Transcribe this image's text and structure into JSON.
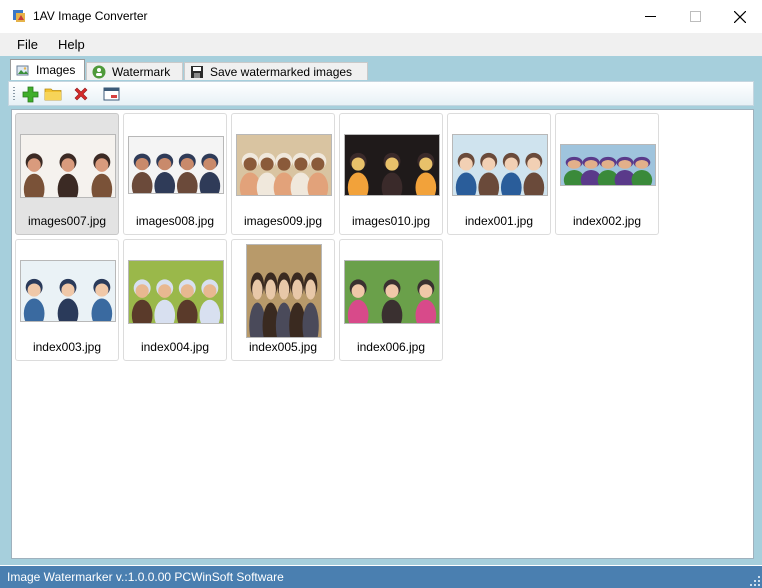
{
  "window": {
    "title": "1AV Image Converter",
    "controls": {
      "minimize": "—",
      "maximize": "☐",
      "close": "✕"
    }
  },
  "menu": {
    "items": [
      "File",
      "Help"
    ]
  },
  "tabs": [
    {
      "label": "Images",
      "icon": "images-icon",
      "active": true
    },
    {
      "label": "Watermark",
      "icon": "watermark-icon",
      "active": false
    },
    {
      "label": "Save watermarked images",
      "icon": "save-icon",
      "active": false
    }
  ],
  "toolbar": {
    "buttons": [
      {
        "name": "add-image-button",
        "icon": "plus-icon"
      },
      {
        "name": "add-folder-button",
        "icon": "folder-icon"
      },
      {
        "name": "remove-button",
        "icon": "delete-icon"
      },
      {
        "name": "preview-button",
        "icon": "window-icon"
      }
    ]
  },
  "images": [
    {
      "filename": "images007.jpg",
      "selected": true,
      "palette": [
        "#f5f2ee",
        "#7a5238",
        "#d99b7d",
        "#3b2a24"
      ]
    },
    {
      "filename": "images008.jpg",
      "selected": false,
      "palette": [
        "#f4f4f4",
        "#6b4a3a",
        "#c98a6b",
        "#2f3b58"
      ]
    },
    {
      "filename": "images009.jpg",
      "selected": false,
      "palette": [
        "#d9c4a1",
        "#e2a27a",
        "#8a5a3a",
        "#f0e8dc"
      ]
    },
    {
      "filename": "images010.jpg",
      "selected": false,
      "palette": [
        "#1f1a1a",
        "#f2a23a",
        "#e8c16a",
        "#3a2a2a"
      ]
    },
    {
      "filename": "index001.jpg",
      "selected": false,
      "palette": [
        "#cfe3ee",
        "#2a5d9a",
        "#f2d0b4",
        "#6a4a3a"
      ]
    },
    {
      "filename": "index002.jpg",
      "selected": false,
      "palette": [
        "#9fc4dd",
        "#3a8a3a",
        "#e2b08a",
        "#5a3a8a"
      ]
    },
    {
      "filename": "index003.jpg",
      "selected": false,
      "palette": [
        "#eaf2f6",
        "#3a6aa0",
        "#f0c8a8",
        "#2a3a5a"
      ]
    },
    {
      "filename": "index004.jpg",
      "selected": false,
      "palette": [
        "#9ab84a",
        "#5a3a2a",
        "#e8b890",
        "#d8e0f0"
      ]
    },
    {
      "filename": "index005.jpg",
      "selected": false,
      "palette": [
        "#b89a6a",
        "#4a4a5a",
        "#e8c8a8",
        "#3a2a20"
      ]
    },
    {
      "filename": "index006.jpg",
      "selected": false,
      "palette": [
        "#6aa04a",
        "#d84a8a",
        "#f0c8a8",
        "#3a3030"
      ]
    }
  ],
  "status": {
    "text": "Image Watermarker v.:1.0.0.00 PCWinSoft Software"
  },
  "colors": {
    "accent": "#a6cfdc",
    "status_bar": "#4a7fb0"
  }
}
